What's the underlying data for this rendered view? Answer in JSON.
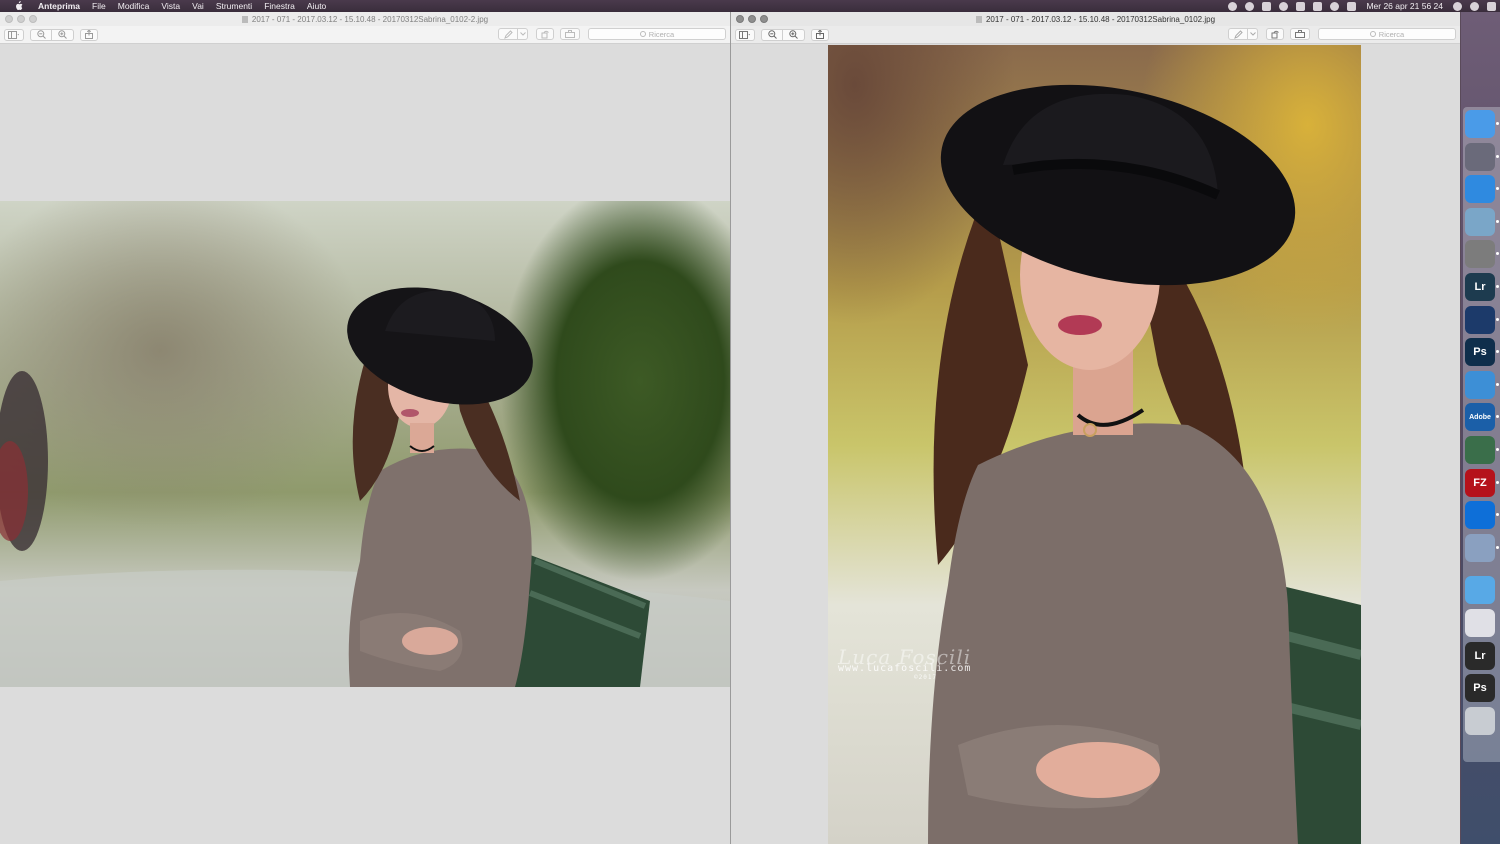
{
  "menubar": {
    "app": "Anteprima",
    "items": [
      "File",
      "Modifica",
      "Vista",
      "Vai",
      "Strumenti",
      "Finestra",
      "Aiuto"
    ],
    "clock": "Mer 26 apr  21 56 24"
  },
  "window_left": {
    "title": "2017 - 071 - 2017.03.12 - 15.10.48 - 20170312Sabrina_0102-2.jpg",
    "search_placeholder": "Ricerca"
  },
  "window_right": {
    "title": "2017 - 071 - 2017.03.12 - 15.10.48 - 20170312Sabrina_0102.jpg",
    "search_placeholder": "Ricerca"
  },
  "watermark": {
    "signature": "Luca Foscili",
    "url": "www.lucafoscili.com",
    "copyright": "©2017"
  },
  "dock": [
    {
      "name": "finder-icon",
      "label": "",
      "color": "#4a9be8"
    },
    {
      "name": "launchpad-icon",
      "label": "",
      "color": "#6a6a7a"
    },
    {
      "name": "safari-icon",
      "label": "",
      "color": "#2f8ae0"
    },
    {
      "name": "preview-icon",
      "label": "",
      "color": "#7aa6c8"
    },
    {
      "name": "system-preferences-icon",
      "label": "",
      "color": "#7c7c7c"
    },
    {
      "name": "lightroom-icon",
      "label": "Lr",
      "color": "#1d3b4f"
    },
    {
      "name": "quicktime-icon",
      "label": "",
      "color": "#1c3a6a"
    },
    {
      "name": "photoshop-icon",
      "label": "Ps",
      "color": "#0f2e4b"
    },
    {
      "name": "creative-cloud-icon",
      "label": "",
      "color": "#3d8fd6"
    },
    {
      "name": "adobe-icon",
      "label": "Adobe",
      "color": "#1b5fa8"
    },
    {
      "name": "transmission-icon",
      "label": "",
      "color": "#3a6e4a"
    },
    {
      "name": "filezilla-icon",
      "label": "FZ",
      "color": "#b5121b"
    },
    {
      "name": "teamviewer-icon",
      "label": "",
      "color": "#0e6fd8"
    },
    {
      "name": "image-capture-icon",
      "label": "",
      "color": "#8aa0c0"
    },
    {
      "name": "downloads-folder-icon",
      "label": "",
      "color": "#58a9e6"
    },
    {
      "name": "documents-stack-icon",
      "label": "",
      "color": "#e0e0e6"
    },
    {
      "name": "lightroom-stack-icon",
      "label": "Lr",
      "color": "#2a2a2a"
    },
    {
      "name": "photoshop-stack-icon",
      "label": "Ps",
      "color": "#2a2a2a"
    },
    {
      "name": "trash-icon",
      "label": "",
      "color": "#c8ccd2"
    }
  ]
}
